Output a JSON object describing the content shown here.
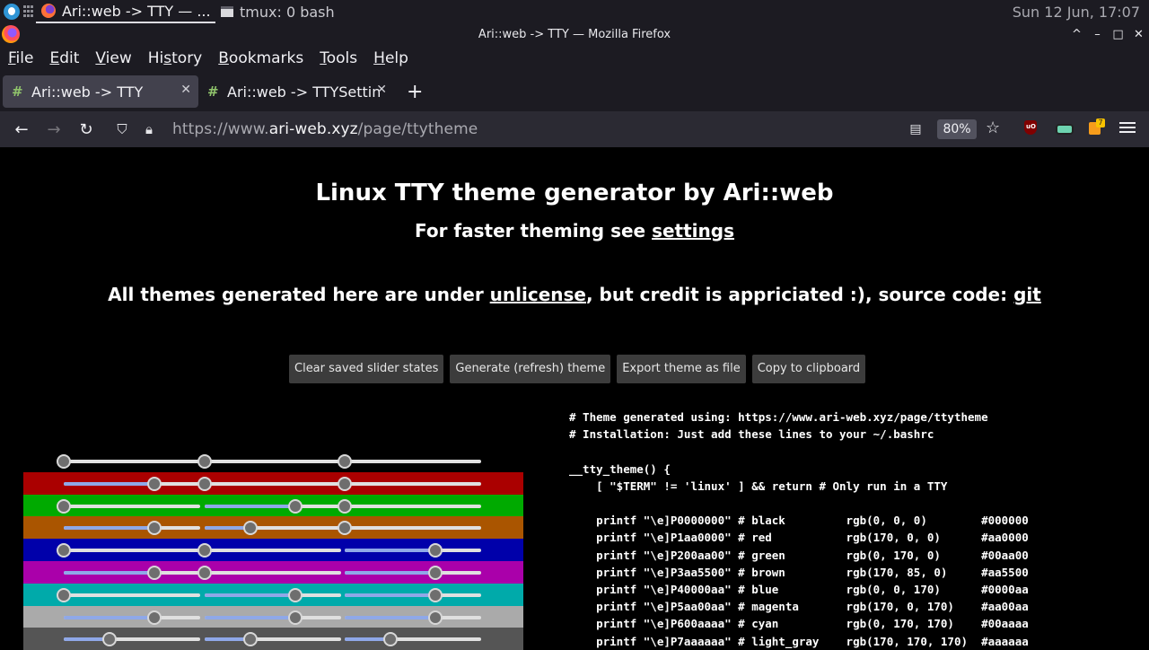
{
  "os_panel": {
    "tasks": [
      {
        "label": "Ari::web -> TTY — ...",
        "active": true
      },
      {
        "label": "tmux: 0 bash",
        "active": false
      }
    ],
    "clock": "Sun 12 Jun, 17:07"
  },
  "window": {
    "title": "Ari::web -> TTY — Mozilla Firefox",
    "controls": [
      "^",
      "–",
      "□",
      "✕"
    ]
  },
  "menu": [
    {
      "label": "File",
      "accel": "F",
      "rest": "ile"
    },
    {
      "label": "Edit",
      "accel": "E",
      "rest": "dit"
    },
    {
      "label": "View",
      "accel": "V",
      "rest": "iew"
    },
    {
      "label": "History",
      "pre": "Hi",
      "accel": "s",
      "rest": "tory"
    },
    {
      "label": "Bookmarks",
      "accel": "B",
      "rest": "ookmarks"
    },
    {
      "label": "Tools",
      "accel": "T",
      "rest": "ools"
    },
    {
      "label": "Help",
      "accel": "H",
      "rest": "elp"
    }
  ],
  "tabs": [
    {
      "title": "Ari::web -> TTY",
      "selected": true
    },
    {
      "title": "Ari::web -> TTYSettings",
      "selected": false
    }
  ],
  "nav": {
    "url_prefix": "https://www.",
    "url_domain": "ari-web.xyz",
    "url_path": "/page/ttytheme",
    "zoom": "80%"
  },
  "extensions": {
    "ublock_badge": "uO",
    "fox_badge": "7"
  },
  "page": {
    "heading": "Linux TTY theme generator by Ari::web",
    "subheading_text": "For faster theming see ",
    "subheading_link": "settings",
    "license_text_1": "All themes generated here are under ",
    "license_link": "unlicense",
    "license_text_2": ", but credit is appriciated :), source code: ",
    "source_link": "git",
    "buttons": {
      "clear": "Clear saved slider states",
      "generate": "Generate (refresh) theme",
      "export": "Export theme as file",
      "copy": "Copy to clipboard"
    }
  },
  "sliders": [
    {
      "name": "black",
      "bg": "#000000",
      "values": [
        0,
        0,
        0
      ]
    },
    {
      "name": "red",
      "bg": "#aa0000",
      "values": [
        170,
        0,
        0
      ]
    },
    {
      "name": "green",
      "bg": "#00aa00",
      "values": [
        0,
        170,
        0
      ]
    },
    {
      "name": "brown",
      "bg": "#aa5500",
      "values": [
        170,
        85,
        0
      ]
    },
    {
      "name": "blue",
      "bg": "#0000aa",
      "values": [
        0,
        0,
        170
      ]
    },
    {
      "name": "magenta",
      "bg": "#aa00aa",
      "values": [
        170,
        0,
        170
      ]
    },
    {
      "name": "cyan",
      "bg": "#00aaaa",
      "values": [
        0,
        170,
        170
      ]
    },
    {
      "name": "light_gray",
      "bg": "#aaaaaa",
      "values": [
        170,
        170,
        170
      ]
    },
    {
      "name": "dark_gray",
      "bg": "#555555",
      "values": [
        85,
        85,
        85
      ]
    }
  ],
  "code_lines": [
    "# Theme generated using: https://www.ari-web.xyz/page/ttytheme",
    "# Installation: Just add these lines to your ~/.bashrc",
    "",
    "__tty_theme() {",
    "    [ \"$TERM\" != 'linux' ] && return # Only run in a TTY",
    "",
    "    printf \"\\e]P0000000\" # black         rgb(0, 0, 0)        #000000",
    "    printf \"\\e]P1aa0000\" # red           rgb(170, 0, 0)      #aa0000",
    "    printf \"\\e]P200aa00\" # green         rgb(0, 170, 0)      #00aa00",
    "    printf \"\\e]P3aa5500\" # brown         rgb(170, 85, 0)     #aa5500",
    "    printf \"\\e]P40000aa\" # blue          rgb(0, 0, 170)      #0000aa",
    "    printf \"\\e]P5aa00aa\" # magenta       rgb(170, 0, 170)    #aa00aa",
    "    printf \"\\e]P600aaaa\" # cyan          rgb(0, 170, 170)    #00aaaa",
    "    printf \"\\e]P7aaaaaa\" # light_gray    rgb(170, 170, 170)  #aaaaaa"
  ]
}
